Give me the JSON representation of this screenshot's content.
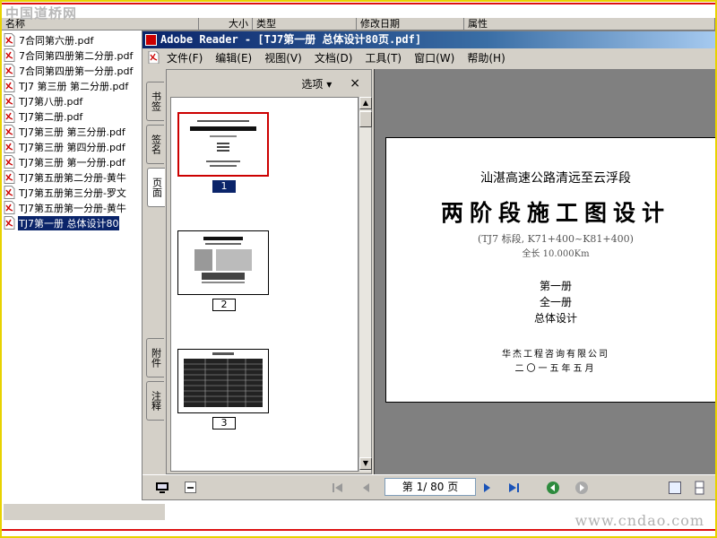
{
  "watermarks": {
    "top_left": "中国道桥网",
    "bottom_right": "www.cndao.com"
  },
  "explorer": {
    "columns": [
      "名称",
      "大小",
      "类型",
      "修改日期",
      "属性"
    ],
    "files": [
      "7合同第六册.pdf",
      "7合同第四册第二分册.pdf",
      "7合同第四册第一分册.pdf",
      "TJ7 第三册 第二分册.pdf",
      "TJ7第八册.pdf",
      "TJ7第二册.pdf",
      "TJ7第三册 第三分册.pdf",
      "TJ7第三册 第四分册.pdf",
      "TJ7第三册 第一分册.pdf",
      "TJ7第五册第二分册-黄牛",
      "TJ7第五册第三分册-罗文",
      "TJ7第五册第一分册-黄牛",
      "TJ7第一册     总体设计80"
    ],
    "selected_index": 12
  },
  "reader": {
    "title": "Adobe Reader - [TJ7第一册    总体设计80页.pdf]",
    "menu": [
      "文件(F)",
      "编辑(E)",
      "视图(V)",
      "文档(D)",
      "工具(T)",
      "窗口(W)",
      "帮助(H)"
    ],
    "side_tabs": [
      "书签",
      "签名",
      "页面",
      "附件",
      "注释"
    ],
    "thumb_pane": {
      "options_label": "选项 ▾",
      "close_label": "×"
    },
    "thumbnails": [
      "1",
      "2",
      "3"
    ],
    "page_field": "第 1/ 80 页",
    "accent": "#0a246a"
  },
  "document": {
    "subtitle": "汕湛高速公路清远至云浮段",
    "title": "两阶段施工图设计",
    "section": "(TJ7 标段, K71+400~K81+400)",
    "length": "全长 10.000Km",
    "volume": "第一册",
    "volume_count": "全一册",
    "volume_name": "总体设计",
    "company": "华杰工程咨询有限公司",
    "date": "二〇一五年五月"
  }
}
